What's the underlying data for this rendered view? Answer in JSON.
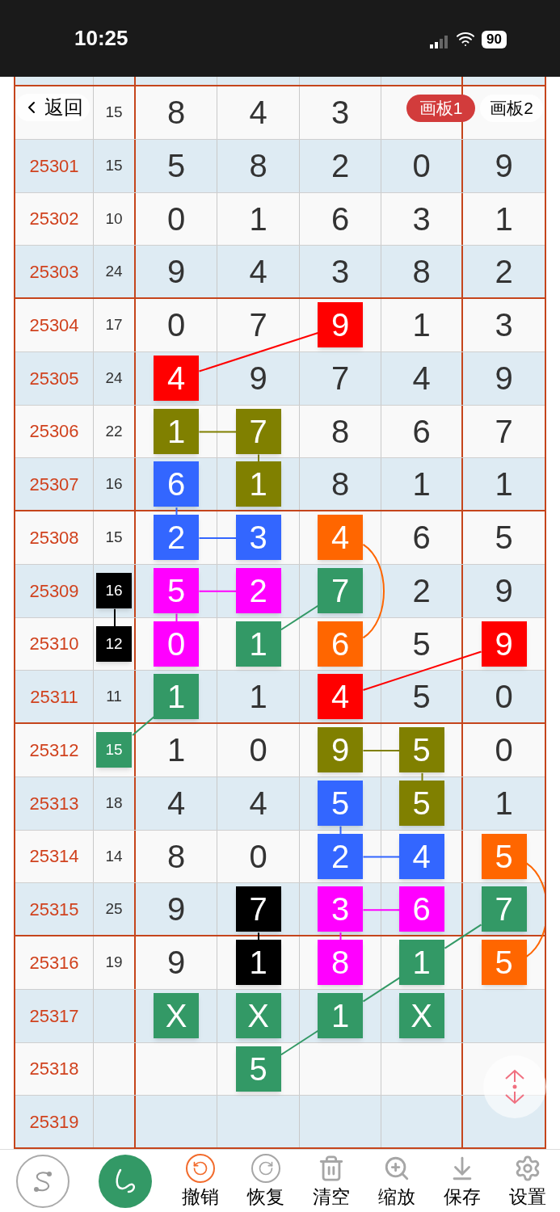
{
  "status_bar": {
    "time": "10:25",
    "battery": "90"
  },
  "nav": {
    "back": "返回",
    "boards": [
      {
        "label": "画板1",
        "selected": true
      },
      {
        "label": "画板2",
        "selected": false
      }
    ]
  },
  "rows": [
    {
      "cells": [
        {
          "value": "15"
        },
        {
          "value": "8"
        },
        {
          "value": "4"
        },
        {
          "value": "3"
        },
        {},
        {}
      ]
    },
    {
      "issue": "25301",
      "cells": [
        {
          "value": "15"
        },
        {
          "value": "5"
        },
        {
          "value": "8"
        },
        {
          "value": "2"
        },
        {
          "value": "0"
        },
        {
          "value": "9"
        }
      ]
    },
    {
      "issue": "25302",
      "cells": [
        {
          "value": "10"
        },
        {
          "value": "0"
        },
        {
          "value": "1"
        },
        {
          "value": "6"
        },
        {
          "value": "3"
        },
        {
          "value": "1"
        }
      ]
    },
    {
      "issue": "25303",
      "cells": [
        {
          "value": "24"
        },
        {
          "value": "9"
        },
        {
          "value": "4"
        },
        {
          "value": "3"
        },
        {
          "value": "8"
        },
        {
          "value": "2"
        }
      ]
    },
    {
      "issue": "25304",
      "cells": [
        {
          "value": "17"
        },
        {
          "value": "0"
        },
        {
          "value": "7"
        },
        {
          "value": "9",
          "color": "#ff0000"
        },
        {
          "value": "1"
        },
        {
          "value": "3"
        }
      ]
    },
    {
      "issue": "25305",
      "cells": [
        {
          "value": "24"
        },
        {
          "value": "4",
          "color": "#ff0000"
        },
        {
          "value": "9"
        },
        {
          "value": "7"
        },
        {
          "value": "4"
        },
        {
          "value": "9"
        }
      ]
    },
    {
      "issue": "25306",
      "cells": [
        {
          "value": "22"
        },
        {
          "value": "1",
          "color": "#808000"
        },
        {
          "value": "7",
          "color": "#808000"
        },
        {
          "value": "8"
        },
        {
          "value": "6"
        },
        {
          "value": "7"
        }
      ]
    },
    {
      "issue": "25307",
      "cells": [
        {
          "value": "16"
        },
        {
          "value": "6",
          "color": "#3366ff"
        },
        {
          "value": "1",
          "color": "#808000"
        },
        {
          "value": "8"
        },
        {
          "value": "1"
        },
        {
          "value": "1"
        }
      ]
    },
    {
      "issue": "25308",
      "cells": [
        {
          "value": "15"
        },
        {
          "value": "2",
          "color": "#3366ff"
        },
        {
          "value": "3",
          "color": "#3366ff"
        },
        {
          "value": "4",
          "color": "#ff6600"
        },
        {
          "value": "6"
        },
        {
          "value": "5"
        }
      ]
    },
    {
      "issue": "25309",
      "cells": [
        {
          "value": "16",
          "color": "#000000"
        },
        {
          "value": "5",
          "color": "#ff00ff"
        },
        {
          "value": "2",
          "color": "#ff00ff"
        },
        {
          "value": "7",
          "color": "#339966"
        },
        {
          "value": "2"
        },
        {
          "value": "9"
        }
      ]
    },
    {
      "issue": "25310",
      "cells": [
        {
          "value": "12",
          "color": "#000000"
        },
        {
          "value": "0",
          "color": "#ff00ff"
        },
        {
          "value": "1",
          "color": "#339966"
        },
        {
          "value": "6",
          "color": "#ff6600"
        },
        {
          "value": "5"
        },
        {
          "value": "9",
          "color": "#ff0000"
        }
      ]
    },
    {
      "issue": "25311",
      "cells": [
        {
          "value": "11"
        },
        {
          "value": "1",
          "color": "#339966"
        },
        {
          "value": "1"
        },
        {
          "value": "4",
          "color": "#ff0000"
        },
        {
          "value": "5"
        },
        {
          "value": "0"
        }
      ]
    },
    {
      "issue": "25312",
      "cells": [
        {
          "value": "15",
          "color": "#339966"
        },
        {
          "value": "1"
        },
        {
          "value": "0"
        },
        {
          "value": "9",
          "color": "#808000"
        },
        {
          "value": "5",
          "color": "#808000"
        },
        {
          "value": "0"
        }
      ]
    },
    {
      "issue": "25313",
      "cells": [
        {
          "value": "18"
        },
        {
          "value": "4"
        },
        {
          "value": "4"
        },
        {
          "value": "5",
          "color": "#3366ff"
        },
        {
          "value": "5",
          "color": "#808000"
        },
        {
          "value": "1"
        }
      ]
    },
    {
      "issue": "25314",
      "cells": [
        {
          "value": "14"
        },
        {
          "value": "8"
        },
        {
          "value": "0"
        },
        {
          "value": "2",
          "color": "#3366ff"
        },
        {
          "value": "4",
          "color": "#3366ff"
        },
        {
          "value": "5",
          "color": "#ff6600"
        }
      ]
    },
    {
      "issue": "25315",
      "cells": [
        {
          "value": "25"
        },
        {
          "value": "9"
        },
        {
          "value": "7",
          "color": "#000000"
        },
        {
          "value": "3",
          "color": "#ff00ff"
        },
        {
          "value": "6",
          "color": "#ff00ff"
        },
        {
          "value": "7",
          "color": "#339966"
        }
      ]
    },
    {
      "issue": "25316",
      "cells": [
        {
          "value": "19"
        },
        {
          "value": "9"
        },
        {
          "value": "1",
          "color": "#000000"
        },
        {
          "value": "8",
          "color": "#ff00ff"
        },
        {
          "value": "1",
          "color": "#339966"
        },
        {
          "value": "5",
          "color": "#ff6600"
        }
      ]
    },
    {
      "issue": "25317",
      "cells": [
        {},
        {
          "value": "X",
          "color": "#339966"
        },
        {
          "value": "X",
          "color": "#339966"
        },
        {
          "value": "1",
          "color": "#339966"
        },
        {
          "value": "X",
          "color": "#339966"
        },
        {}
      ]
    },
    {
      "issue": "25318",
      "cells": [
        {},
        {},
        {
          "value": "5",
          "color": "#339966"
        },
        {},
        {},
        {}
      ]
    },
    {
      "issue": "25319",
      "cells": [
        {},
        {},
        {},
        {},
        {},
        {}
      ]
    }
  ],
  "tools": {
    "modes": [
      {
        "kind": "line",
        "selected": false
      },
      {
        "kind": "freehand",
        "selected": true
      }
    ],
    "actions": [
      {
        "kind": "undo",
        "label": "撤销",
        "highlighted": true
      },
      {
        "kind": "redo",
        "label": "恢复",
        "highlighted": false
      },
      {
        "kind": "clear",
        "label": "清空",
        "highlighted": false
      },
      {
        "kind": "zoom",
        "label": "缩放",
        "highlighted": false
      },
      {
        "kind": "save",
        "label": "保存",
        "highlighted": false
      },
      {
        "kind": "settings",
        "label": "设置",
        "highlighted": false
      }
    ]
  }
}
